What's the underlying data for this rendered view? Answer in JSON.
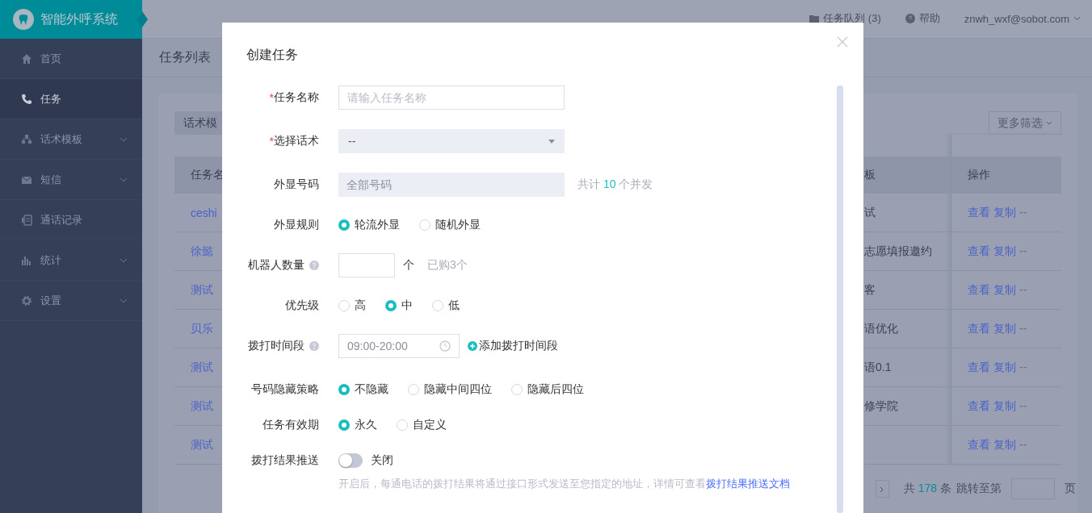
{
  "app": {
    "title": "智能外呼系统"
  },
  "sidebar": {
    "items": [
      {
        "label": "首页",
        "selected": false,
        "expandable": false
      },
      {
        "label": "任务",
        "selected": true,
        "expandable": false
      },
      {
        "label": "话术模板",
        "selected": false,
        "expandable": true
      },
      {
        "label": "短信",
        "selected": false,
        "expandable": true
      },
      {
        "label": "通话记录",
        "selected": false,
        "expandable": false
      },
      {
        "label": "统计",
        "selected": false,
        "expandable": true
      },
      {
        "label": "设置",
        "selected": false,
        "expandable": true
      }
    ]
  },
  "header": {
    "queue": "任务队列 (3)",
    "help": "帮助",
    "user": "znwh_wxf@sobot.com"
  },
  "page": {
    "title": "任务列表",
    "filter_label": "话术模",
    "more_filter": "更多筛选",
    "table": {
      "columns": [
        "任务名",
        "板",
        "操作"
      ],
      "rows": [
        {
          "name": "ceshi",
          "template": "试",
          "actions": [
            "查看",
            "复制",
            "--"
          ]
        },
        {
          "name": "徐懿",
          "template": "志愿填报邀约",
          "actions": [
            "查看",
            "复制",
            "--"
          ]
        },
        {
          "name": "测试",
          "template": "客",
          "actions": [
            "查看",
            "复制",
            "--"
          ]
        },
        {
          "name": "贝乐",
          "template": "语优化",
          "actions": [
            "查看",
            "复制",
            "--"
          ]
        },
        {
          "name": "测试",
          "template": "语0.1",
          "actions": [
            "查看",
            "复制",
            "--"
          ]
        },
        {
          "name": "测试",
          "template": "修学院",
          "actions": [
            "查看",
            "复制",
            "--"
          ]
        },
        {
          "name": "测试",
          "actions": [
            "查看",
            "复制",
            "--"
          ]
        }
      ]
    },
    "pagination": {
      "total_prefix": "共",
      "total": "178",
      "total_suffix": "条",
      "jump": "跳转至第",
      "page_suffix": "页"
    }
  },
  "modal": {
    "title": "创建任务",
    "required_mark": "*",
    "fields": [
      {
        "kind": "text",
        "label": "任务名称",
        "required": true,
        "help": false,
        "placeholder": "请输入任务名称"
      },
      {
        "kind": "select",
        "label": "选择话术",
        "required": true,
        "help": false,
        "value": "--"
      },
      {
        "kind": "readonly",
        "label": "外显号码",
        "required": false,
        "help": false,
        "placeholder": "全部号码",
        "note_prefix": "共计",
        "note_count": "10",
        "note_suffix": "个并发"
      },
      {
        "kind": "radio",
        "label": "外显规则",
        "required": false,
        "help": false,
        "options": [
          {
            "label": "轮流外显",
            "selected": true
          },
          {
            "label": "随机外显",
            "selected": false
          }
        ]
      },
      {
        "kind": "number",
        "label": "机器人数量",
        "required": false,
        "help": true,
        "unit": "个",
        "note": "已购3个"
      },
      {
        "kind": "radio",
        "label": "优先级",
        "required": false,
        "help": false,
        "options": [
          {
            "label": "高",
            "selected": false
          },
          {
            "label": "中",
            "selected": true
          },
          {
            "label": "低",
            "selected": false
          }
        ]
      },
      {
        "kind": "time",
        "label": "拨打时间段",
        "required": false,
        "help": true,
        "value": "09:00-20:00",
        "add": "添加拨打时间段"
      },
      {
        "kind": "radio",
        "label": "号码隐藏策略",
        "required": false,
        "help": false,
        "options": [
          {
            "label": "不隐藏",
            "selected": true
          },
          {
            "label": "隐藏中间四位",
            "selected": false
          },
          {
            "label": "隐藏后四位",
            "selected": false
          }
        ]
      },
      {
        "kind": "radio",
        "label": "任务有效期",
        "required": false,
        "help": false,
        "options": [
          {
            "label": "永久",
            "selected": true
          },
          {
            "label": "自定义",
            "selected": false
          }
        ]
      },
      {
        "kind": "switch",
        "label": "拨打结果推送",
        "required": false,
        "help": false,
        "on": false,
        "state_text": "关闭",
        "hint": "开启后，每通电话的拨打结果将通过接口形式发送至您指定的地址，详情可查看",
        "link": "拨打结果推送文档"
      }
    ]
  }
}
